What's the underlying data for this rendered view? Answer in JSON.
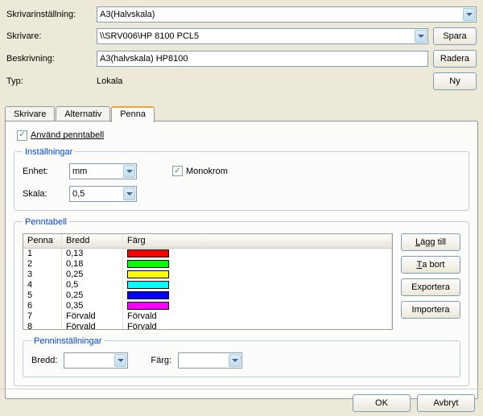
{
  "top": {
    "printerSettingLabel": "Skrivarinställning:",
    "printerSettingValue": "A3(Halvskala)",
    "printerLabel": "Skrivare:",
    "printerValue": "\\\\SRV006\\HP 8100 PCL5",
    "saveBtn": "Spara",
    "descriptionLabel": "Beskrivning:",
    "descriptionValue": "A3(halvskala) HP8100",
    "deleteBtn": "Radera",
    "typeLabel": "Typ:",
    "typeValue": "Lokala",
    "newBtn": "Ny"
  },
  "tabs": {
    "printer": "Skrivare",
    "options": "Alternativ",
    "pen": "Penna"
  },
  "penTab": {
    "usePenTable": "Använd penntabell",
    "settingsLegend": "Inställningar",
    "unitLabel": "Enhet:",
    "unitValue": "mm",
    "monochrome": "Monokrom",
    "scaleLabel": "Skala:",
    "scaleValue": "0,5",
    "penTableLegend": "Penntabell",
    "col_penna": "Penna",
    "col_bredd": "Bredd",
    "col_farg": "Färg",
    "rows": [
      {
        "penna": "1",
        "bredd": "0,13",
        "color": "#ff0000"
      },
      {
        "penna": "2",
        "bredd": "0,18",
        "color": "#00ff00"
      },
      {
        "penna": "3",
        "bredd": "0,25",
        "color": "#ffff00"
      },
      {
        "penna": "4",
        "bredd": "0,5",
        "color": "#00ffff"
      },
      {
        "penna": "5",
        "bredd": "0,25",
        "color": "#0000ff"
      },
      {
        "penna": "6",
        "bredd": "0,35",
        "color": "#ff00ff"
      },
      {
        "penna": "7",
        "bredd": "Förvald",
        "farg_text": "Förvald"
      },
      {
        "penna": "8",
        "bredd": "Förvald",
        "farg_text": "Förvald"
      }
    ],
    "addBtn": "Lägg till",
    "removeBtn": "Ta bort",
    "exportBtn": "Exportera",
    "importBtn": "Importera",
    "penSettingsLegend": "Penninställningar",
    "widthLabel": "Bredd:",
    "colorLabel": "Färg:"
  },
  "footer": {
    "ok": "OK",
    "cancel": "Avbryt"
  }
}
